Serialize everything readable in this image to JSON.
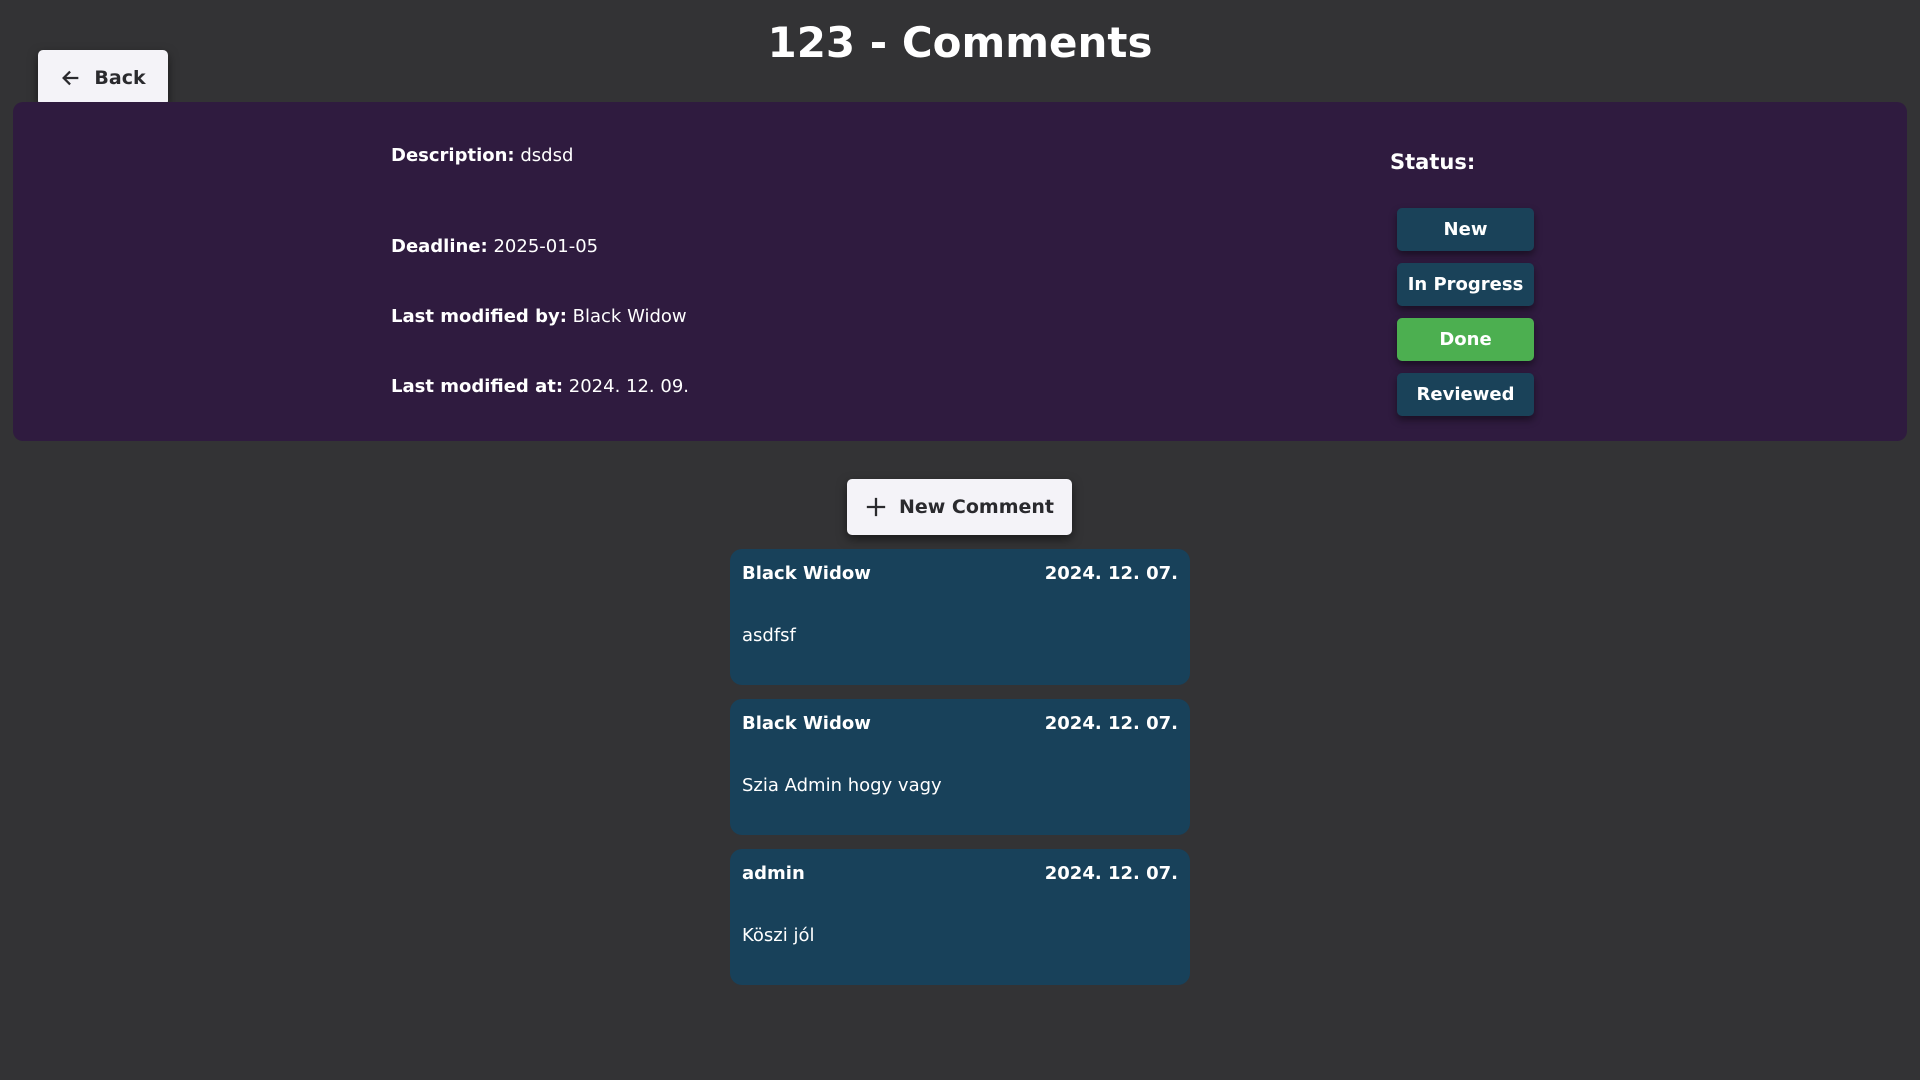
{
  "header": {
    "title": "123 - Comments",
    "back_label": "Back"
  },
  "task": {
    "description_label": "Description:",
    "description": "dsdsd",
    "deadline_label": "Deadline:",
    "deadline": "2025-01-05",
    "modified_by_label": "Last modified by:",
    "modified_by": "Black Widow",
    "modified_at_label": "Last modified at:",
    "modified_at": "2024. 12. 09."
  },
  "status": {
    "label": "Status:",
    "options": [
      "New",
      "In Progress",
      "Done",
      "Reviewed"
    ],
    "selected": "Done",
    "colors": {
      "default": "#1a4259",
      "selected": "#4caf50"
    }
  },
  "new_comment_label": "New Comment",
  "comments": [
    {
      "author": "Black Widow",
      "date": "2024. 12. 07.",
      "text": "asdfsf"
    },
    {
      "author": "Black Widow",
      "date": "2024. 12. 07.",
      "text": "Szia Admin hogy vagy"
    },
    {
      "author": "admin",
      "date": "2024. 12. 07.",
      "text": "Köszi jól"
    }
  ]
}
